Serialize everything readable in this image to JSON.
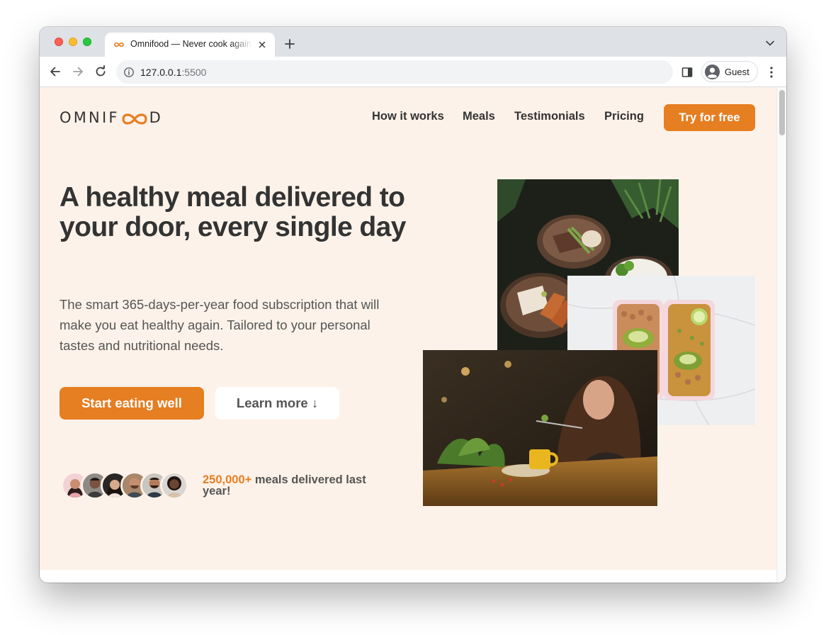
{
  "browser": {
    "tab_title": "Omnifood — Never cook again!",
    "url_host": "127.0.0.1",
    "url_port": ":5500",
    "profile_name": "Guest"
  },
  "page": {
    "logo": {
      "text_before": "OMNIF",
      "text_after": "D"
    },
    "nav": {
      "links": [
        "How it works",
        "Meals",
        "Testimonials",
        "Pricing"
      ],
      "cta": "Try for free"
    },
    "hero": {
      "title": "A healthy meal delivered to your door, every single day",
      "description": "The smart 365-days-per-year food subscription that will make you eat healthy again. Tailored to your personal tastes and nutritional needs.",
      "primary_button": "Start eating well",
      "secondary_button": "Learn more ↓",
      "delivered_number": "250,000+",
      "delivered_text": "meals delivered last year!",
      "customer_count_shown": 6
    }
  },
  "colors": {
    "brand": "#e67e22",
    "hero_bg": "#fdf2e9",
    "heading": "#333333",
    "body_text": "#555555"
  },
  "icons": [
    "infinity-favicon-icon",
    "close-icon",
    "plus-icon",
    "chevron-down-icon",
    "back-arrow-icon",
    "forward-arrow-icon",
    "reload-icon",
    "info-icon",
    "side-panel-icon",
    "account-icon",
    "more-vert-icon"
  ]
}
